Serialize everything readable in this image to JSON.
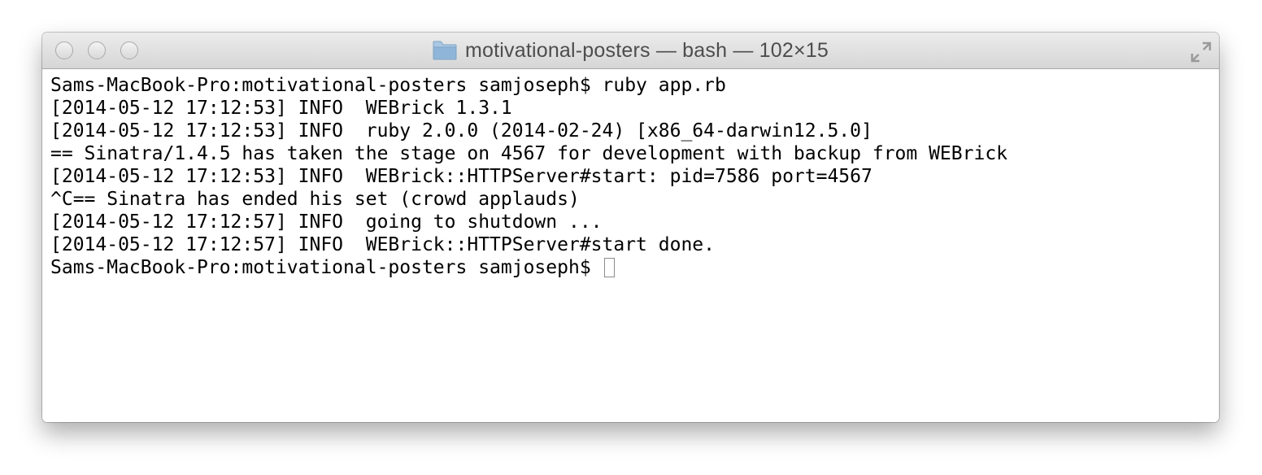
{
  "window": {
    "title": "motivational-posters — bash — 102×15"
  },
  "terminal": {
    "lines": [
      "Sams-MacBook-Pro:motivational-posters samjoseph$ ruby app.rb",
      "[2014-05-12 17:12:53] INFO  WEBrick 1.3.1",
      "[2014-05-12 17:12:53] INFO  ruby 2.0.0 (2014-02-24) [x86_64-darwin12.5.0]",
      "== Sinatra/1.4.5 has taken the stage on 4567 for development with backup from WEBrick",
      "[2014-05-12 17:12:53] INFO  WEBrick::HTTPServer#start: pid=7586 port=4567",
      "^C== Sinatra has ended his set (crowd applauds)",
      "[2014-05-12 17:12:57] INFO  going to shutdown ...",
      "[2014-05-12 17:12:57] INFO  WEBrick::HTTPServer#start done."
    ],
    "prompt": "Sams-MacBook-Pro:motivational-posters samjoseph$ "
  },
  "icons": {
    "folder": "folder-icon",
    "resize": "fullscreen-icon"
  },
  "colors": {
    "text": "#000000",
    "titlebar": "#dcdcdc",
    "folder": "#8ab4d6"
  }
}
